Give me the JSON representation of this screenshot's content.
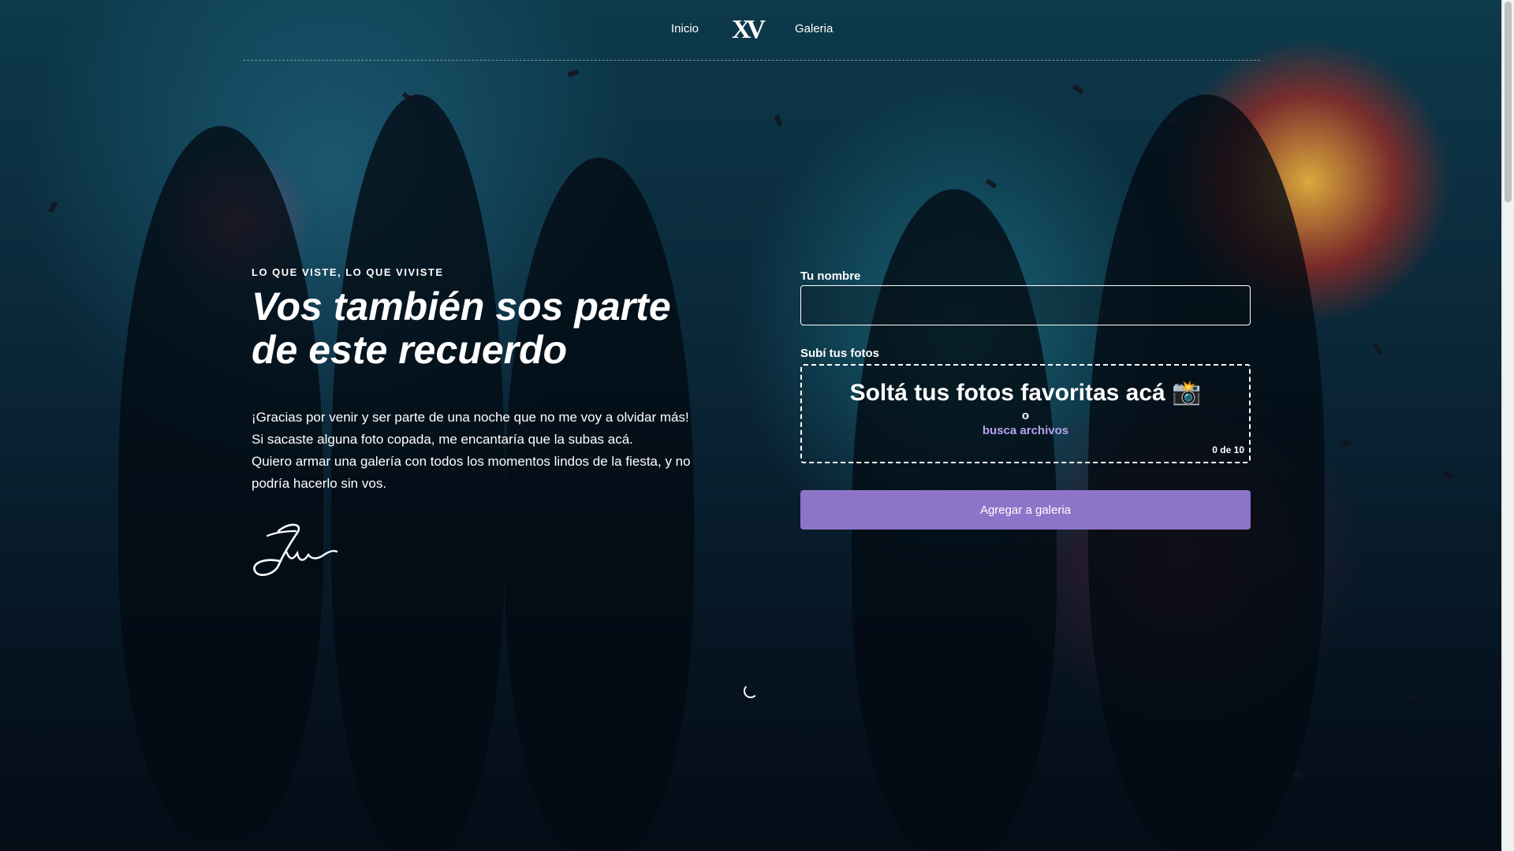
{
  "nav": {
    "inicio": "Inicio",
    "logo": "XV",
    "galeria": "Galeria"
  },
  "hero": {
    "eyebrow": "LO QUE VISTE, LO QUE VIVISTE",
    "title": "Vos también sos parte de este recuerdo",
    "paragraph": [
      "¡Gracias por venir y ser parte de una noche que no me voy a olvidar más!",
      "Si sacaste alguna foto copada, me encantaría que la subas acá.",
      "Quiero armar una galería con todos los momentos lindos de la fiesta, y no podría hacerlo sin vos."
    ],
    "signature": "Ju"
  },
  "form": {
    "name_label": "Tu nombre",
    "name_value": "",
    "photos_label": "Subí tus fotos",
    "dropzone_title": "Soltá tus fotos favoritas acá 📸",
    "dropzone_or": "o",
    "dropzone_browse": "busca archivos",
    "file_count": "0 de 10",
    "submit_label": "Agregar a galeria"
  },
  "colors": {
    "accent": "#8e74c8",
    "link": "#b6a1ee",
    "background": "#0a2536"
  }
}
